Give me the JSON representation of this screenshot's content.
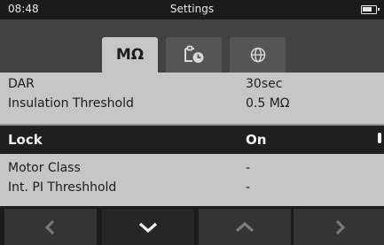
{
  "status_bar": {
    "time": "08:48",
    "title": "Settings"
  },
  "tabs": [
    {
      "id": "insulation",
      "label": "MΩ",
      "selected": true
    },
    {
      "id": "timer",
      "icon": "timer-clipboard-icon",
      "selected": false
    },
    {
      "id": "region",
      "icon": "globe-icon",
      "selected": false
    }
  ],
  "settings": [
    {
      "label": "DAR",
      "value": "30sec"
    },
    {
      "label": "Insulation Threshold",
      "value": "0.5 MΩ"
    },
    {
      "label": "Lock",
      "value": "On",
      "selected": true
    },
    {
      "label": "Motor Class",
      "value": "-"
    },
    {
      "label": "Int. PI Threshhold",
      "value": "-"
    }
  ],
  "softkeys": [
    {
      "icon": "chevron-left-icon",
      "enabled": false
    },
    {
      "icon": "chevron-down-icon",
      "enabled": true
    },
    {
      "icon": "chevron-up-icon",
      "enabled": false
    },
    {
      "icon": "chevron-right-icon",
      "enabled": false
    }
  ],
  "colors": {
    "statusbar_bg": "#1b1b1b",
    "tabstrip_bg": "#424242",
    "list_bg": "#c6c6c6",
    "selected_row_bg": "#1f1f1f",
    "softkey_bg": "#343434",
    "softkey_enabled_icon": "#f2f2f2",
    "softkey_disabled_icon": "#7a7a7a"
  }
}
